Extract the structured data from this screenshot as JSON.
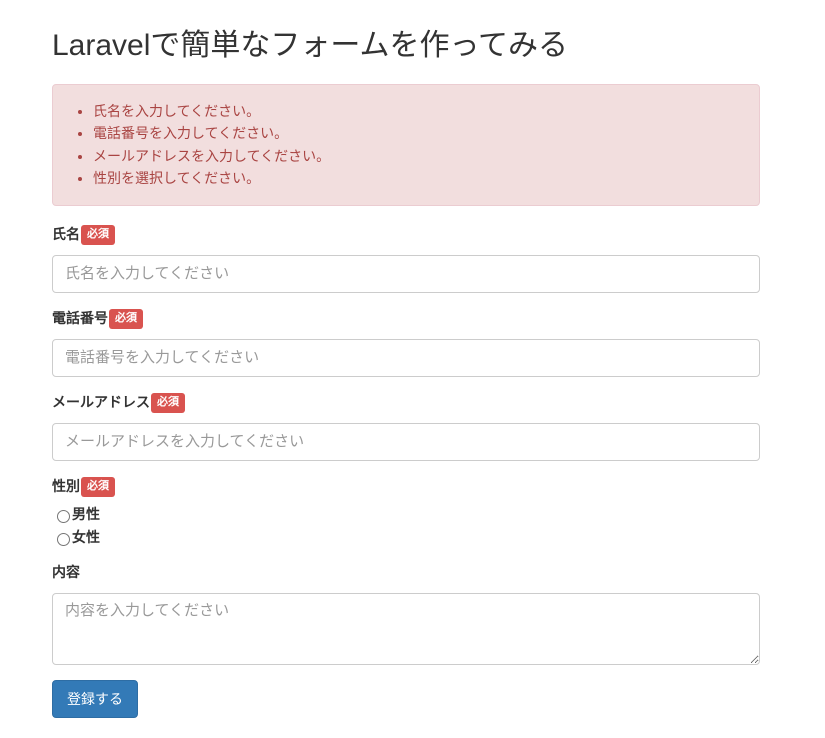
{
  "page": {
    "title": "Laravelで簡単なフォームを作ってみる"
  },
  "errors": [
    "氏名を入力してください。",
    "電話番号を入力してください。",
    "メールアドレスを入力してください。",
    "性別を選択してください。"
  ],
  "required_badge": "必須",
  "fields": {
    "name": {
      "label": "氏名",
      "placeholder": "氏名を入力してください",
      "value": ""
    },
    "phone": {
      "label": "電話番号",
      "placeholder": "電話番号を入力してください",
      "value": ""
    },
    "email": {
      "label": "メールアドレス",
      "placeholder": "メールアドレスを入力してください",
      "value": ""
    },
    "gender": {
      "label": "性別",
      "options": [
        "男性",
        "女性"
      ]
    },
    "content": {
      "label": "内容",
      "placeholder": "内容を入力してください",
      "value": ""
    }
  },
  "submit_label": "登録する"
}
